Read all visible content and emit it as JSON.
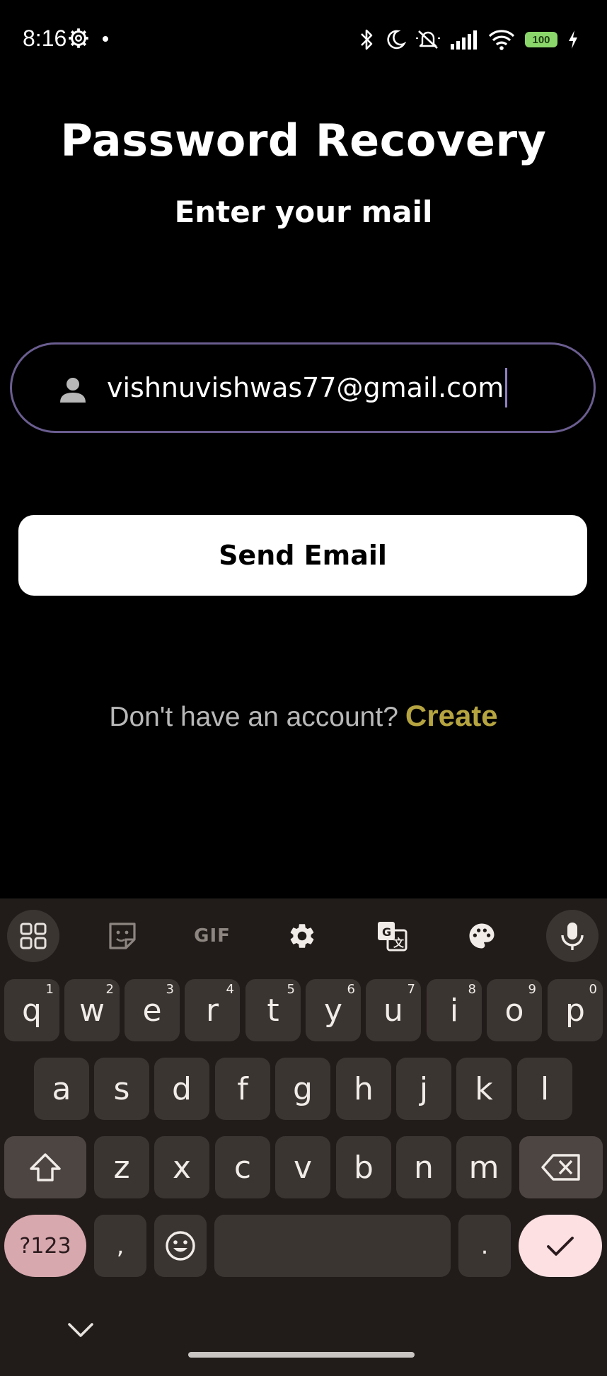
{
  "status_bar": {
    "time": "8:16",
    "battery": "100"
  },
  "header": {
    "title": "Password Recovery",
    "subtitle": "Enter your mail"
  },
  "email_input": {
    "value": "vishnuvishwas77@gmail.com",
    "icon": "person-icon"
  },
  "send_button": {
    "label": "Send Email"
  },
  "account": {
    "prompt": "Don't have an account?",
    "link": "Create"
  },
  "colors": {
    "background": "#000000",
    "input_border": "#6a5d8f",
    "link": "#b5a440",
    "keyboard_bg": "#211c1a",
    "key_bg": "#3b3532",
    "symbols_key": "#d7a8ae",
    "enter_key": "#fde0e2"
  },
  "keyboard": {
    "toolbar": {
      "items": [
        "apps-grid-icon",
        "sticker-icon",
        "GIF",
        "settings-icon",
        "translate-icon",
        "palette-icon",
        "microphone-icon"
      ],
      "gif_label": "GIF"
    },
    "row1": [
      {
        "key": "q",
        "hint": "1"
      },
      {
        "key": "w",
        "hint": "2"
      },
      {
        "key": "e",
        "hint": "3"
      },
      {
        "key": "r",
        "hint": "4"
      },
      {
        "key": "t",
        "hint": "5"
      },
      {
        "key": "y",
        "hint": "6"
      },
      {
        "key": "u",
        "hint": "7"
      },
      {
        "key": "i",
        "hint": "8"
      },
      {
        "key": "o",
        "hint": "9"
      },
      {
        "key": "p",
        "hint": "0"
      }
    ],
    "row2": [
      "a",
      "s",
      "d",
      "f",
      "g",
      "h",
      "j",
      "k",
      "l"
    ],
    "row3": [
      "z",
      "x",
      "c",
      "v",
      "b",
      "n",
      "m"
    ],
    "row4": {
      "symbols": "?123",
      "comma": ",",
      "period": "."
    }
  }
}
